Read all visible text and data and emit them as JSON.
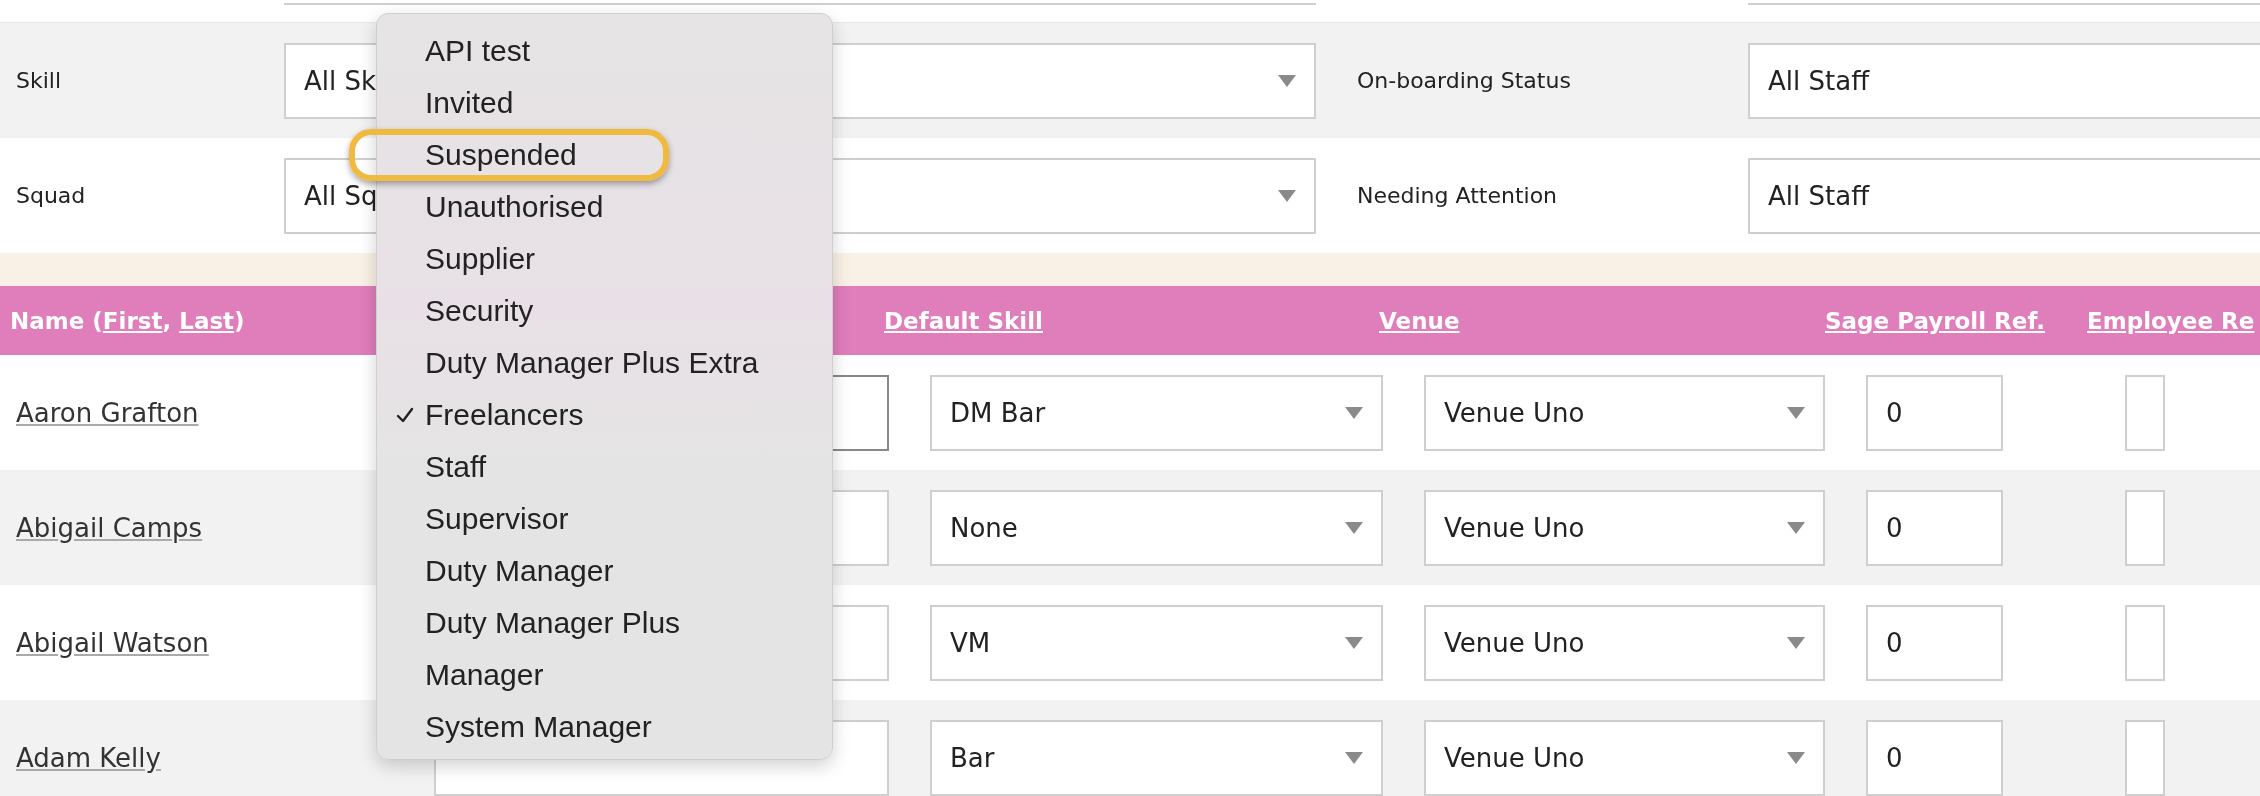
{
  "filter_rows": [
    {
      "left": {
        "label": "Skill",
        "value": "All Sk"
      },
      "right": {
        "label": "On-boarding Status",
        "value": "All Staff"
      }
    },
    {
      "left": {
        "label": "Squad",
        "value": "All Sq"
      },
      "right": {
        "label": "Needing Attention",
        "value": "All Staff"
      }
    }
  ],
  "table": {
    "name_column": {
      "prefix": "Name (",
      "sort_links": [
        "First",
        "Last"
      ],
      "separator": ", ",
      "suffix": ")"
    },
    "columns": [
      "Default Skill",
      "Venue",
      "Sage Payroll Ref.",
      "Employee Re"
    ],
    "rows": [
      {
        "name": "Aaron Grafton",
        "staff_type_focused": true,
        "default_skill": "DM Bar",
        "venue": "Venue Uno",
        "sage_ref": "0"
      },
      {
        "name": "Abigail Camps",
        "staff_type_focused": false,
        "default_skill": "None",
        "venue": "Venue Uno",
        "sage_ref": "0"
      },
      {
        "name": "Abigail Watson",
        "staff_type_focused": false,
        "default_skill": "VM",
        "venue": "Venue Uno",
        "sage_ref": "0"
      },
      {
        "name": "Adam Kelly",
        "staff_type_focused": false,
        "default_skill": "Bar",
        "venue": "Venue Uno",
        "sage_ref": "0"
      }
    ]
  },
  "menu": {
    "items": [
      {
        "label": "API test",
        "selected": false,
        "circled": false
      },
      {
        "label": "Invited",
        "selected": false,
        "circled": false
      },
      {
        "label": "Suspended",
        "selected": false,
        "circled": true
      },
      {
        "label": "Unauthorised",
        "selected": false,
        "circled": false
      },
      {
        "label": "Supplier",
        "selected": false,
        "circled": false
      },
      {
        "label": "Security",
        "selected": false,
        "circled": false
      },
      {
        "label": "Duty Manager Plus Extra",
        "selected": false,
        "circled": false
      },
      {
        "label": "Freelancers",
        "selected": true,
        "circled": false
      },
      {
        "label": "Staff",
        "selected": false,
        "circled": false
      },
      {
        "label": "Supervisor",
        "selected": false,
        "circled": false
      },
      {
        "label": "Duty Manager",
        "selected": false,
        "circled": false
      },
      {
        "label": "Duty Manager Plus",
        "selected": false,
        "circled": false
      },
      {
        "label": "Manager",
        "selected": false,
        "circled": false
      },
      {
        "label": "System Manager",
        "selected": false,
        "circled": false
      }
    ]
  }
}
